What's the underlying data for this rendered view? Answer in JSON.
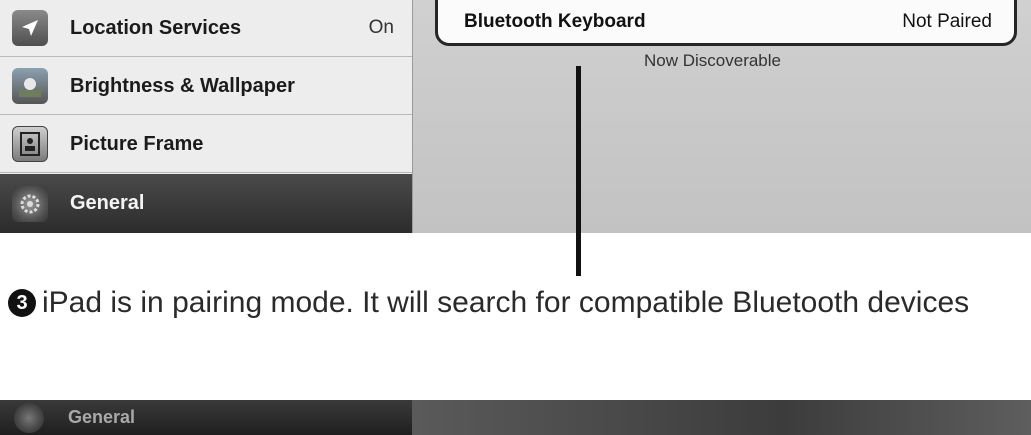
{
  "sidebar": {
    "items": [
      {
        "label": "Location Services",
        "value": "On",
        "icon": "location-arrow-icon"
      },
      {
        "label": "Brightness & Wallpaper",
        "value": "",
        "icon": "flower-icon"
      },
      {
        "label": "Picture Frame",
        "value": "",
        "icon": "picture-frame-icon"
      },
      {
        "label": "General",
        "value": "",
        "icon": "gear-icon",
        "selected": true
      }
    ]
  },
  "detail": {
    "device_name": "Bluetooth Keyboard",
    "device_status": "Not Paired",
    "discoverable_text": "Now Discoverable"
  },
  "caption": {
    "step_number": "3",
    "text": "iPad is in pairing mode. It will search for compatible Bluetooth devices"
  },
  "bottom": {
    "sidebar_label": "General",
    "icon": "gear-icon"
  }
}
